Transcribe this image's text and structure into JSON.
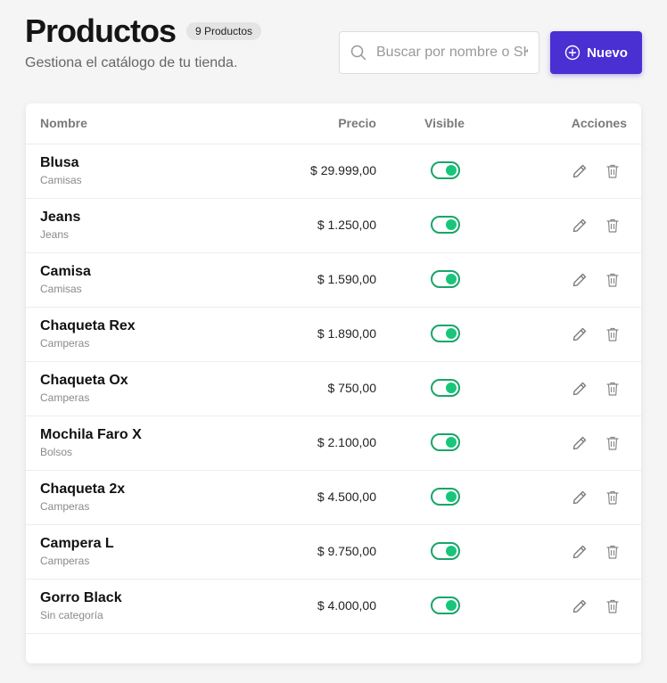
{
  "header": {
    "title": "Productos",
    "count_badge": "9 Productos",
    "subtitle": "Gestiona el catálogo de tu tienda."
  },
  "search": {
    "placeholder": "Buscar por nombre o SKU",
    "value": "",
    "icon": "search-icon"
  },
  "new_button": {
    "label": "Nuevo",
    "icon": "plus-circle-icon",
    "color": "#4a2fd3"
  },
  "table": {
    "columns": [
      "Nombre",
      "Precio",
      "Visible",
      "Acciones"
    ],
    "rows": [
      {
        "name": "Blusa",
        "category": "Camisas",
        "price": "$ 29.999,00",
        "visible": true
      },
      {
        "name": "Jeans",
        "category": "Jeans",
        "price": "$ 1.250,00",
        "visible": true
      },
      {
        "name": "Camisa",
        "category": "Camisas",
        "price": "$ 1.590,00",
        "visible": true
      },
      {
        "name": "Chaqueta Rex",
        "category": "Camperas",
        "price": "$ 1.890,00",
        "visible": true
      },
      {
        "name": "Chaqueta Ox",
        "category": "Camperas",
        "price": "$ 750,00",
        "visible": true
      },
      {
        "name": "Mochila Faro X",
        "category": "Bolsos",
        "price": "$ 2.100,00",
        "visible": true
      },
      {
        "name": "Chaqueta 2x",
        "category": "Camperas",
        "price": "$ 4.500,00",
        "visible": true
      },
      {
        "name": "Campera L",
        "category": "Camperas",
        "price": "$ 9.750,00",
        "visible": true
      },
      {
        "name": "Gorro Black",
        "category": "Sin categoría",
        "price": "$ 4.000,00",
        "visible": true
      }
    ],
    "toggle_color": "#18c67a",
    "action_icons": [
      "pencil-icon",
      "trash-icon"
    ]
  }
}
